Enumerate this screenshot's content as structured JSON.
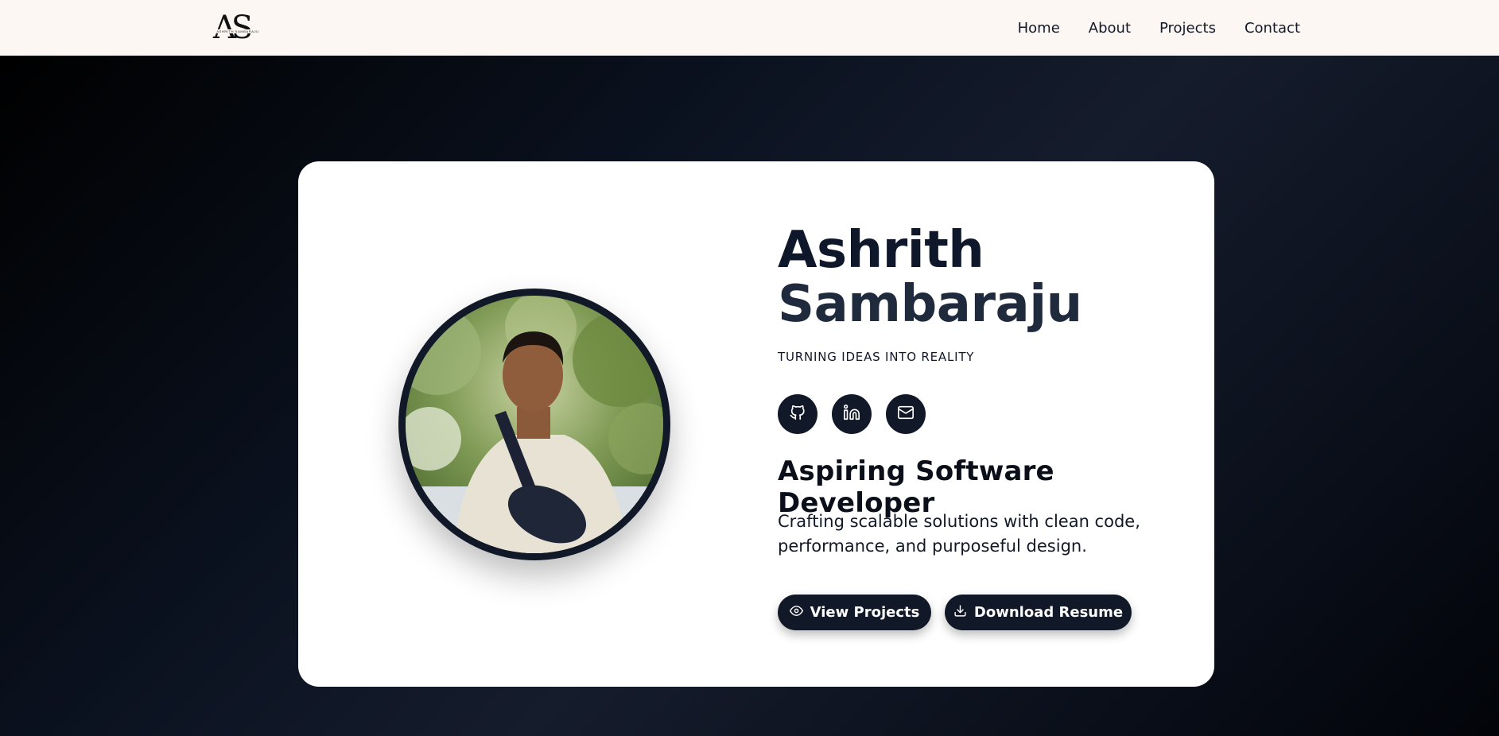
{
  "header": {
    "logo": {
      "mark": "AS",
      "subtitle": "ASHRITH SAMBARAJU"
    },
    "nav": [
      "Home",
      "About",
      "Projects",
      "Contact"
    ]
  },
  "hero": {
    "name_line1": "Ashrith",
    "name_line2": "Sambaraju",
    "tagline": "TURNING IDEAS INTO REALITY",
    "socials": [
      {
        "icon": "github-icon"
      },
      {
        "icon": "linkedin-icon"
      },
      {
        "icon": "mail-icon"
      }
    ],
    "role": "Aspiring Software Developer",
    "description": "Crafting scalable solutions with clean code, performance, and purposeful design.",
    "buttons": {
      "view_projects": "View Projects",
      "download_resume": "Download Resume"
    }
  },
  "colors": {
    "header_bg": "#fdf7f4",
    "card_bg": "#ffffff",
    "accent_dark": "#111827"
  }
}
